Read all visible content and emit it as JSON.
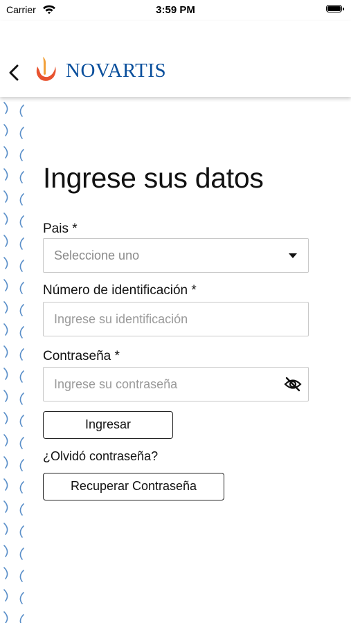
{
  "status_bar": {
    "carrier": "Carrier",
    "time": "3:59 PM"
  },
  "header": {
    "brand_name": "NOVARTIS",
    "brand_color": "#0a4f9c",
    "logo_flame_colors": [
      "#e8532f",
      "#f2a13a"
    ]
  },
  "page": {
    "title": "Ingrese sus datos"
  },
  "form": {
    "country": {
      "label": "Pais *",
      "selected_value": "Seleccione uno"
    },
    "id_number": {
      "label": "Número de identificación  *",
      "placeholder": "Ingrese su identificación"
    },
    "password": {
      "label": "Contraseña *",
      "placeholder": "Ingrese su contraseña"
    },
    "submit_label": "Ingresar",
    "forgot_text": "¿Olvidó contraseña?",
    "recover_label": "Recuperar Contraseña"
  },
  "icons": {
    "back": "chevron-left-icon",
    "wifi": "wifi-icon",
    "battery": "battery-icon",
    "dropdown": "caret-down-icon",
    "password_visibility": "eye-slash-icon"
  }
}
